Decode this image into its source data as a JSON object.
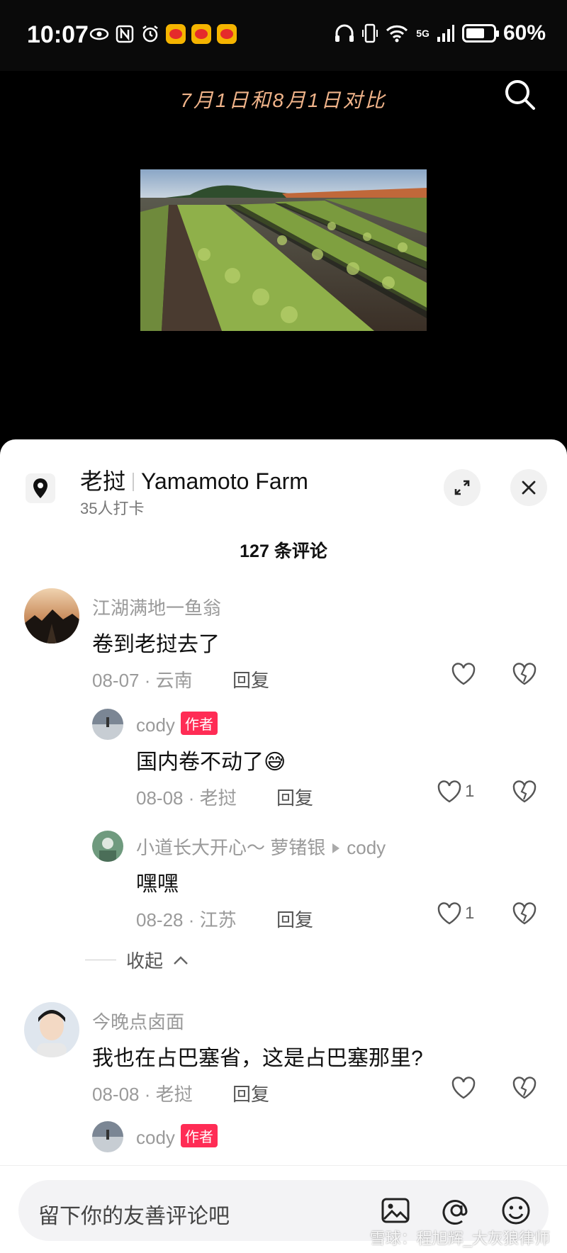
{
  "status_bar": {
    "time": "10:07",
    "network": "5G",
    "battery": "60%"
  },
  "video": {
    "caption": "7月1日和8月1日对比"
  },
  "location": {
    "name_cn": "老挝",
    "name_en": "Yamamoto Farm",
    "checkins": "35人打卡"
  },
  "comments_header": {
    "count": "127 条评论"
  },
  "comments": [
    {
      "user": "江湖满地一鱼翁",
      "text": "卷到老挝去了",
      "date": "08-07 · 云南",
      "reply": "回复",
      "likes": ""
    },
    {
      "user": "cody",
      "badge": "作者",
      "text": "国内卷不动了😅",
      "date": "08-08 · 老挝",
      "reply": "回复",
      "likes": "1"
    },
    {
      "user": "小道长大开心～ 萝锗银",
      "reply_to": "cody",
      "text": "嘿嘿",
      "date": "08-28 · 江苏",
      "reply": "回复",
      "likes": "1"
    },
    {
      "user": "今晚点卤面",
      "text": "我也在占巴塞省，这是占巴塞那里?",
      "date": "08-08 · 老挝",
      "reply": "回复",
      "likes": ""
    },
    {
      "user": "cody",
      "badge": "作者",
      "text": "",
      "date": "",
      "reply": "",
      "likes": ""
    }
  ],
  "collapse": {
    "label": "收起"
  },
  "input": {
    "placeholder": "留下你的友善评论吧"
  },
  "watermark": "雪球：程旭辉_大灰狼律师",
  "colors": {
    "author_badge": "#ff2c55",
    "caption": "#f1b48a"
  }
}
